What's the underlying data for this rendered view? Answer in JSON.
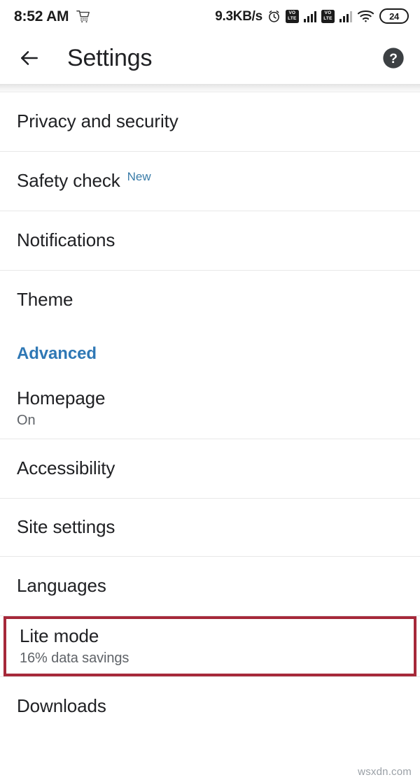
{
  "statusbar": {
    "time": "8:52 AM",
    "shopping_icon": "shopping-cart-icon",
    "network_speed": "9.3KB/s",
    "alarm_icon": "alarm-clock-icon",
    "volte1_line1": "VO",
    "volte1_line2": "LTE",
    "volte2_line1": "VO",
    "volte2_line2": "LTE",
    "wifi_icon": "wifi-icon",
    "battery_level": "24"
  },
  "appbar": {
    "back_icon": "back-arrow-icon",
    "title": "Settings",
    "help_icon": "help-circle-icon"
  },
  "list": [
    {
      "type": "row",
      "name": "privacy-and-security",
      "title": "Privacy and security"
    },
    {
      "type": "row",
      "name": "safety-check",
      "title": "Safety check",
      "badge": "New"
    },
    {
      "type": "row",
      "name": "notifications",
      "title": "Notifications"
    },
    {
      "type": "row",
      "name": "theme",
      "title": "Theme"
    },
    {
      "type": "section",
      "name": "advanced",
      "title": "Advanced"
    },
    {
      "type": "row",
      "name": "homepage",
      "title": "Homepage",
      "subtitle": "On"
    },
    {
      "type": "row",
      "name": "accessibility",
      "title": "Accessibility"
    },
    {
      "type": "row",
      "name": "site-settings",
      "title": "Site settings"
    },
    {
      "type": "row",
      "name": "languages",
      "title": "Languages"
    },
    {
      "type": "row",
      "name": "lite-mode",
      "title": "Lite mode",
      "subtitle": "16% data savings",
      "highlighted": true
    },
    {
      "type": "row",
      "name": "downloads",
      "title": "Downloads"
    }
  ],
  "colors": {
    "highlight_border": "#a6293a",
    "section_header": "#2f78b5",
    "badge_new": "#3a7ca8",
    "primary_text": "#202124",
    "secondary_text": "#5f6368",
    "divider": "#e8e8e8"
  },
  "watermark": "wsxdn.com"
}
